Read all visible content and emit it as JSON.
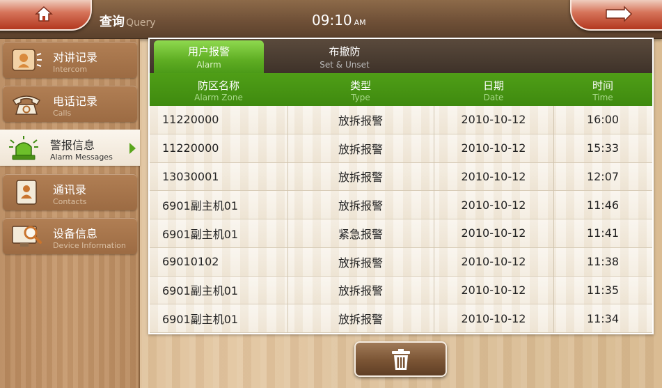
{
  "header": {
    "title_cn": "查询",
    "title_en": "Query",
    "time": "09:10",
    "ampm": "AM",
    "home_icon": "home-icon",
    "back_icon": "return-arrow-icon"
  },
  "sidebar": {
    "items": [
      {
        "cn": "对讲记录",
        "en": "Intercom",
        "icon": "intercom-icon",
        "active": false
      },
      {
        "cn": "电话记录",
        "en": "Calls",
        "icon": "telephone-icon",
        "active": false
      },
      {
        "cn": "警报信息",
        "en": "Alarm Messages",
        "icon": "alarm-siren-icon",
        "active": true
      },
      {
        "cn": "通讯录",
        "en": "Contacts",
        "icon": "contacts-icon",
        "active": false
      },
      {
        "cn": "设备信息",
        "en": "Device Information",
        "icon": "device-search-icon",
        "active": false
      }
    ]
  },
  "tabs": [
    {
      "cn": "用户报警",
      "en": "Alarm",
      "active": true
    },
    {
      "cn": "布撤防",
      "en": "Set & Unset",
      "active": false
    }
  ],
  "table": {
    "columns": [
      {
        "cn": "防区名称",
        "en": "Alarm Zone"
      },
      {
        "cn": "类型",
        "en": "Type"
      },
      {
        "cn": "日期",
        "en": "Date"
      },
      {
        "cn": "时间",
        "en": "Time"
      }
    ],
    "rows": [
      [
        "11220000",
        "放拆报警",
        "2010-10-12",
        "16:00"
      ],
      [
        "11220000",
        "放拆报警",
        "2010-10-12",
        "15:33"
      ],
      [
        "13030001",
        "放拆报警",
        "2010-10-12",
        "12:07"
      ],
      [
        "6901副主机01",
        "放拆报警",
        "2010-10-12",
        "11:46"
      ],
      [
        "6901副主机01",
        "紧急报警",
        "2010-10-12",
        "11:41"
      ],
      [
        "69010102",
        "放拆报警",
        "2010-10-12",
        "11:38"
      ],
      [
        "6901副主机01",
        "放拆报警",
        "2010-10-12",
        "11:35"
      ],
      [
        "6901副主机01",
        "放拆报警",
        "2010-10-12",
        "11:34"
      ]
    ]
  },
  "delete_button": {
    "icon": "trash-icon"
  },
  "colors": {
    "accent_green": "#4f9e17",
    "tab_green": "#5fae23",
    "button_red": "#b3371f",
    "wood_brown": "#7a5434"
  }
}
